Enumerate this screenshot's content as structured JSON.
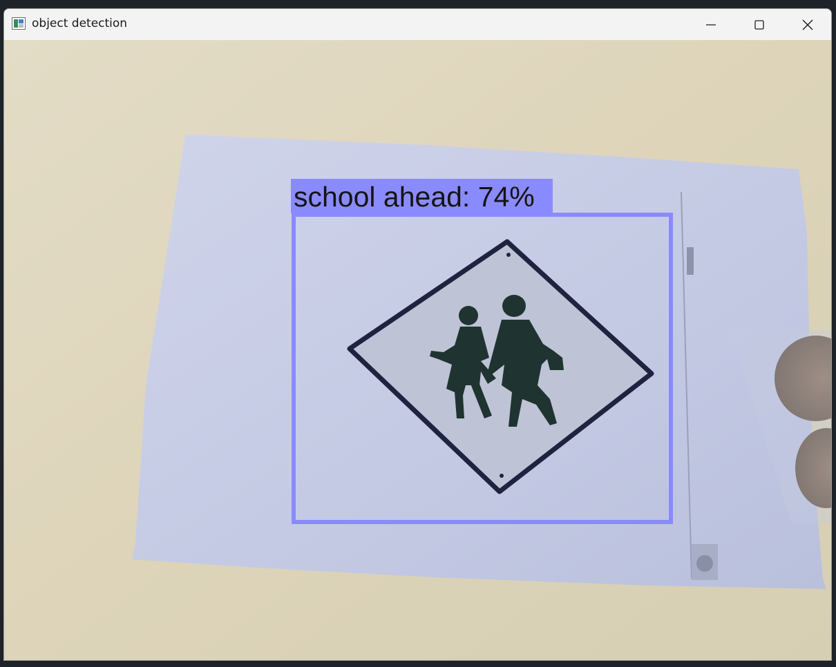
{
  "window": {
    "title": "object detection",
    "icon": "opencv-window-icon",
    "controls": {
      "minimize": "minimize-icon",
      "maximize": "maximize-icon",
      "close": "close-icon"
    }
  },
  "detection": {
    "label": "school ahead: 74%",
    "class_name": "school ahead",
    "confidence_percent": 74,
    "box_color": "#8a8aff"
  },
  "colors": {
    "sign_outline": "#1e2340",
    "figures": "#1f3430",
    "background": "#ddd6c0",
    "paper": "#c9cfe6"
  }
}
